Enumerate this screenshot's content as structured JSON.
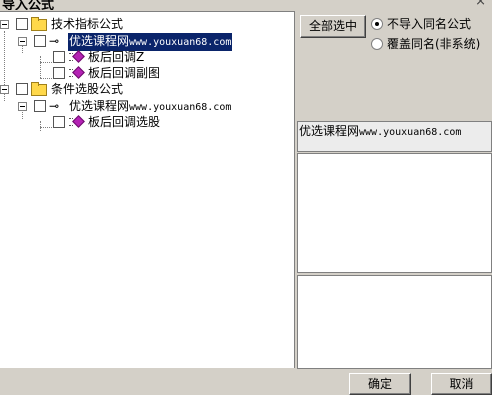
{
  "window": {
    "title": "导入公式",
    "close_glyph": "×"
  },
  "tree": {
    "groups": [
      {
        "label": "技术指标公式",
        "items": [
          {
            "label": "优选课程网",
            "label_mono": "www.youxuan68.com",
            "selected": true,
            "children": [
              {
                "label": "板后回调Z"
              },
              {
                "label": "板后回调副图"
              }
            ]
          }
        ]
      },
      {
        "label": "条件选股公式",
        "items": [
          {
            "label": "优选课程网",
            "label_mono": "www.youxuan68.com",
            "selected": false,
            "children": [
              {
                "label": "板后回调选股"
              }
            ]
          }
        ]
      }
    ]
  },
  "right": {
    "select_all_label": "全部选中",
    "options": [
      {
        "label": "不导入同名公式",
        "checked": true
      },
      {
        "label": "覆盖同名(非系统)",
        "checked": false
      }
    ],
    "desc": {
      "label": "优选课程网",
      "label_mono": "www.youxuan68.com"
    }
  },
  "footer": {
    "ok_label": "确定",
    "cancel_label": "取消"
  },
  "colors": {
    "selection_bg": "#0a246a",
    "dialog_bg": "#d4d0c8",
    "gem": "#b422b4",
    "folder": "#ffd84a"
  },
  "icons": [
    "folder-icon",
    "formula-key-icon",
    "formula-gem-icon",
    "expander-minus-icon",
    "close-icon"
  ]
}
